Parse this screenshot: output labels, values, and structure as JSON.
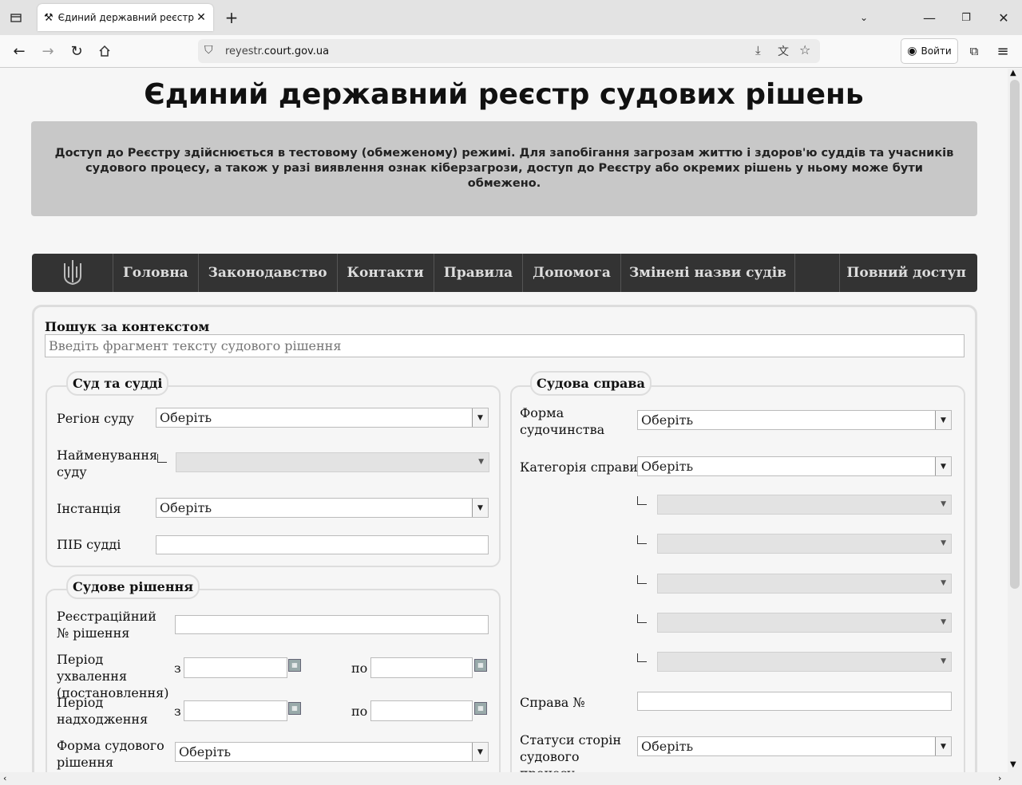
{
  "browser": {
    "tab_title": "Єдиний державний реєстр судо",
    "url_prefix": "reyestr.",
    "url_domain": "court.gov.ua",
    "login_label": "Войти",
    "icons": [
      "tab-overview-icon",
      "gavel-icon",
      "close-icon",
      "new-tab-icon",
      "list-tabs-icon",
      "minimize-icon",
      "restore-icon",
      "window-close-icon",
      "back-icon",
      "forward-icon",
      "reload-icon",
      "home-icon",
      "site-info-icon",
      "download-icon",
      "translate-icon",
      "star-icon",
      "account-icon",
      "extensions-icon",
      "menu-icon"
    ]
  },
  "page": {
    "title": "Єдиний державний реєстр судових рішень",
    "notice": "Доступ до Реєстру здійснюється в тестовому (обмеженому) режимі. Для запобігання загрозам життю і здоров'ю суддів та учасників судового процесу, а також у разі виявлення ознак кіберзагрози, доступ до Реєстру або окремих рішень у ньому може бути обмежено."
  },
  "menu": {
    "items": [
      "Головна",
      "Законодавство",
      "Контакти",
      "Правила",
      "Допомога",
      "Змінені назви судів"
    ],
    "full_access": "Повний доступ"
  },
  "form": {
    "context_label": "Пошук за контекстом",
    "context_placeholder": "Введіть фрагмент тексту судового рішення",
    "court_section": {
      "legend": "Суд та судді",
      "region_label": "Регіон суду",
      "region_value": "Оберіть",
      "court_name_label": "Найменування суду",
      "instance_label": "Інстанція",
      "instance_value": "Оберіть",
      "judge_label": "ПІБ судді"
    },
    "decision_section": {
      "legend": "Судове рішення",
      "reg_no_label": "Реєстраційний № рішення",
      "period_adopt_label": "Період ухвалення (постановлення)",
      "period_receive_label": "Період надходження",
      "from_label": "з",
      "to_label": "по",
      "form_label": "Форма судового рішення",
      "form_value": "Оберіть"
    },
    "case_section": {
      "legend": "Судова справа",
      "proceeding_label": "Форма судочинства",
      "proceeding_value": "Оберіть",
      "category_label": "Категорія справи",
      "category_value": "Оберіть",
      "case_no_label": "Справа №",
      "statuses_label": "Статуси сторін судового процесу",
      "statuses_value": "Оберіть"
    }
  }
}
